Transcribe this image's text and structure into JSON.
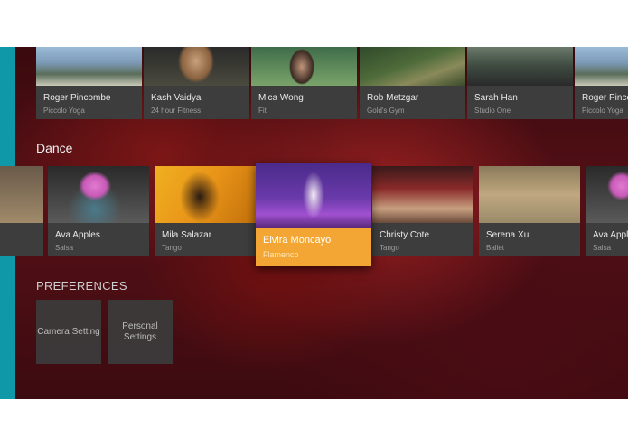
{
  "row1": [
    {
      "name": "Roger Pincombe",
      "studio": "Piccolo Yoga"
    },
    {
      "name": "Kash Vaidya",
      "studio": "24 hour Fitness"
    },
    {
      "name": "Mica Wong",
      "studio": "Fit"
    },
    {
      "name": "Rob Metzgar",
      "studio": "Gold's Gym"
    },
    {
      "name": "Sarah Han",
      "studio": "Studio One"
    },
    {
      "name": "Roger Pinco",
      "studio": "Piccolo Yoga"
    }
  ],
  "dance": {
    "heading": "Dance",
    "items": [
      {
        "name": "",
        "style": ""
      },
      {
        "name": "Ava Apples",
        "style": "Salsa"
      },
      {
        "name": "Mila Salazar",
        "style": "Tango"
      },
      {
        "name": "Elvira Moncayo",
        "style": "Flamenco"
      },
      {
        "name": "Christy Cote",
        "style": "Tango"
      },
      {
        "name": "Serena Xu",
        "style": "Ballet"
      },
      {
        "name": "Ava Apple",
        "style": "Salsa"
      }
    ],
    "selected_index": 3
  },
  "preferences": {
    "heading": "PREFERENCES",
    "tiles": [
      "Camera Setting",
      "Personal Settings"
    ]
  },
  "colors": {
    "accent_bar": "#0e98a8",
    "selected_card": "#f3a633",
    "card_bg": "#3d3d3d"
  }
}
